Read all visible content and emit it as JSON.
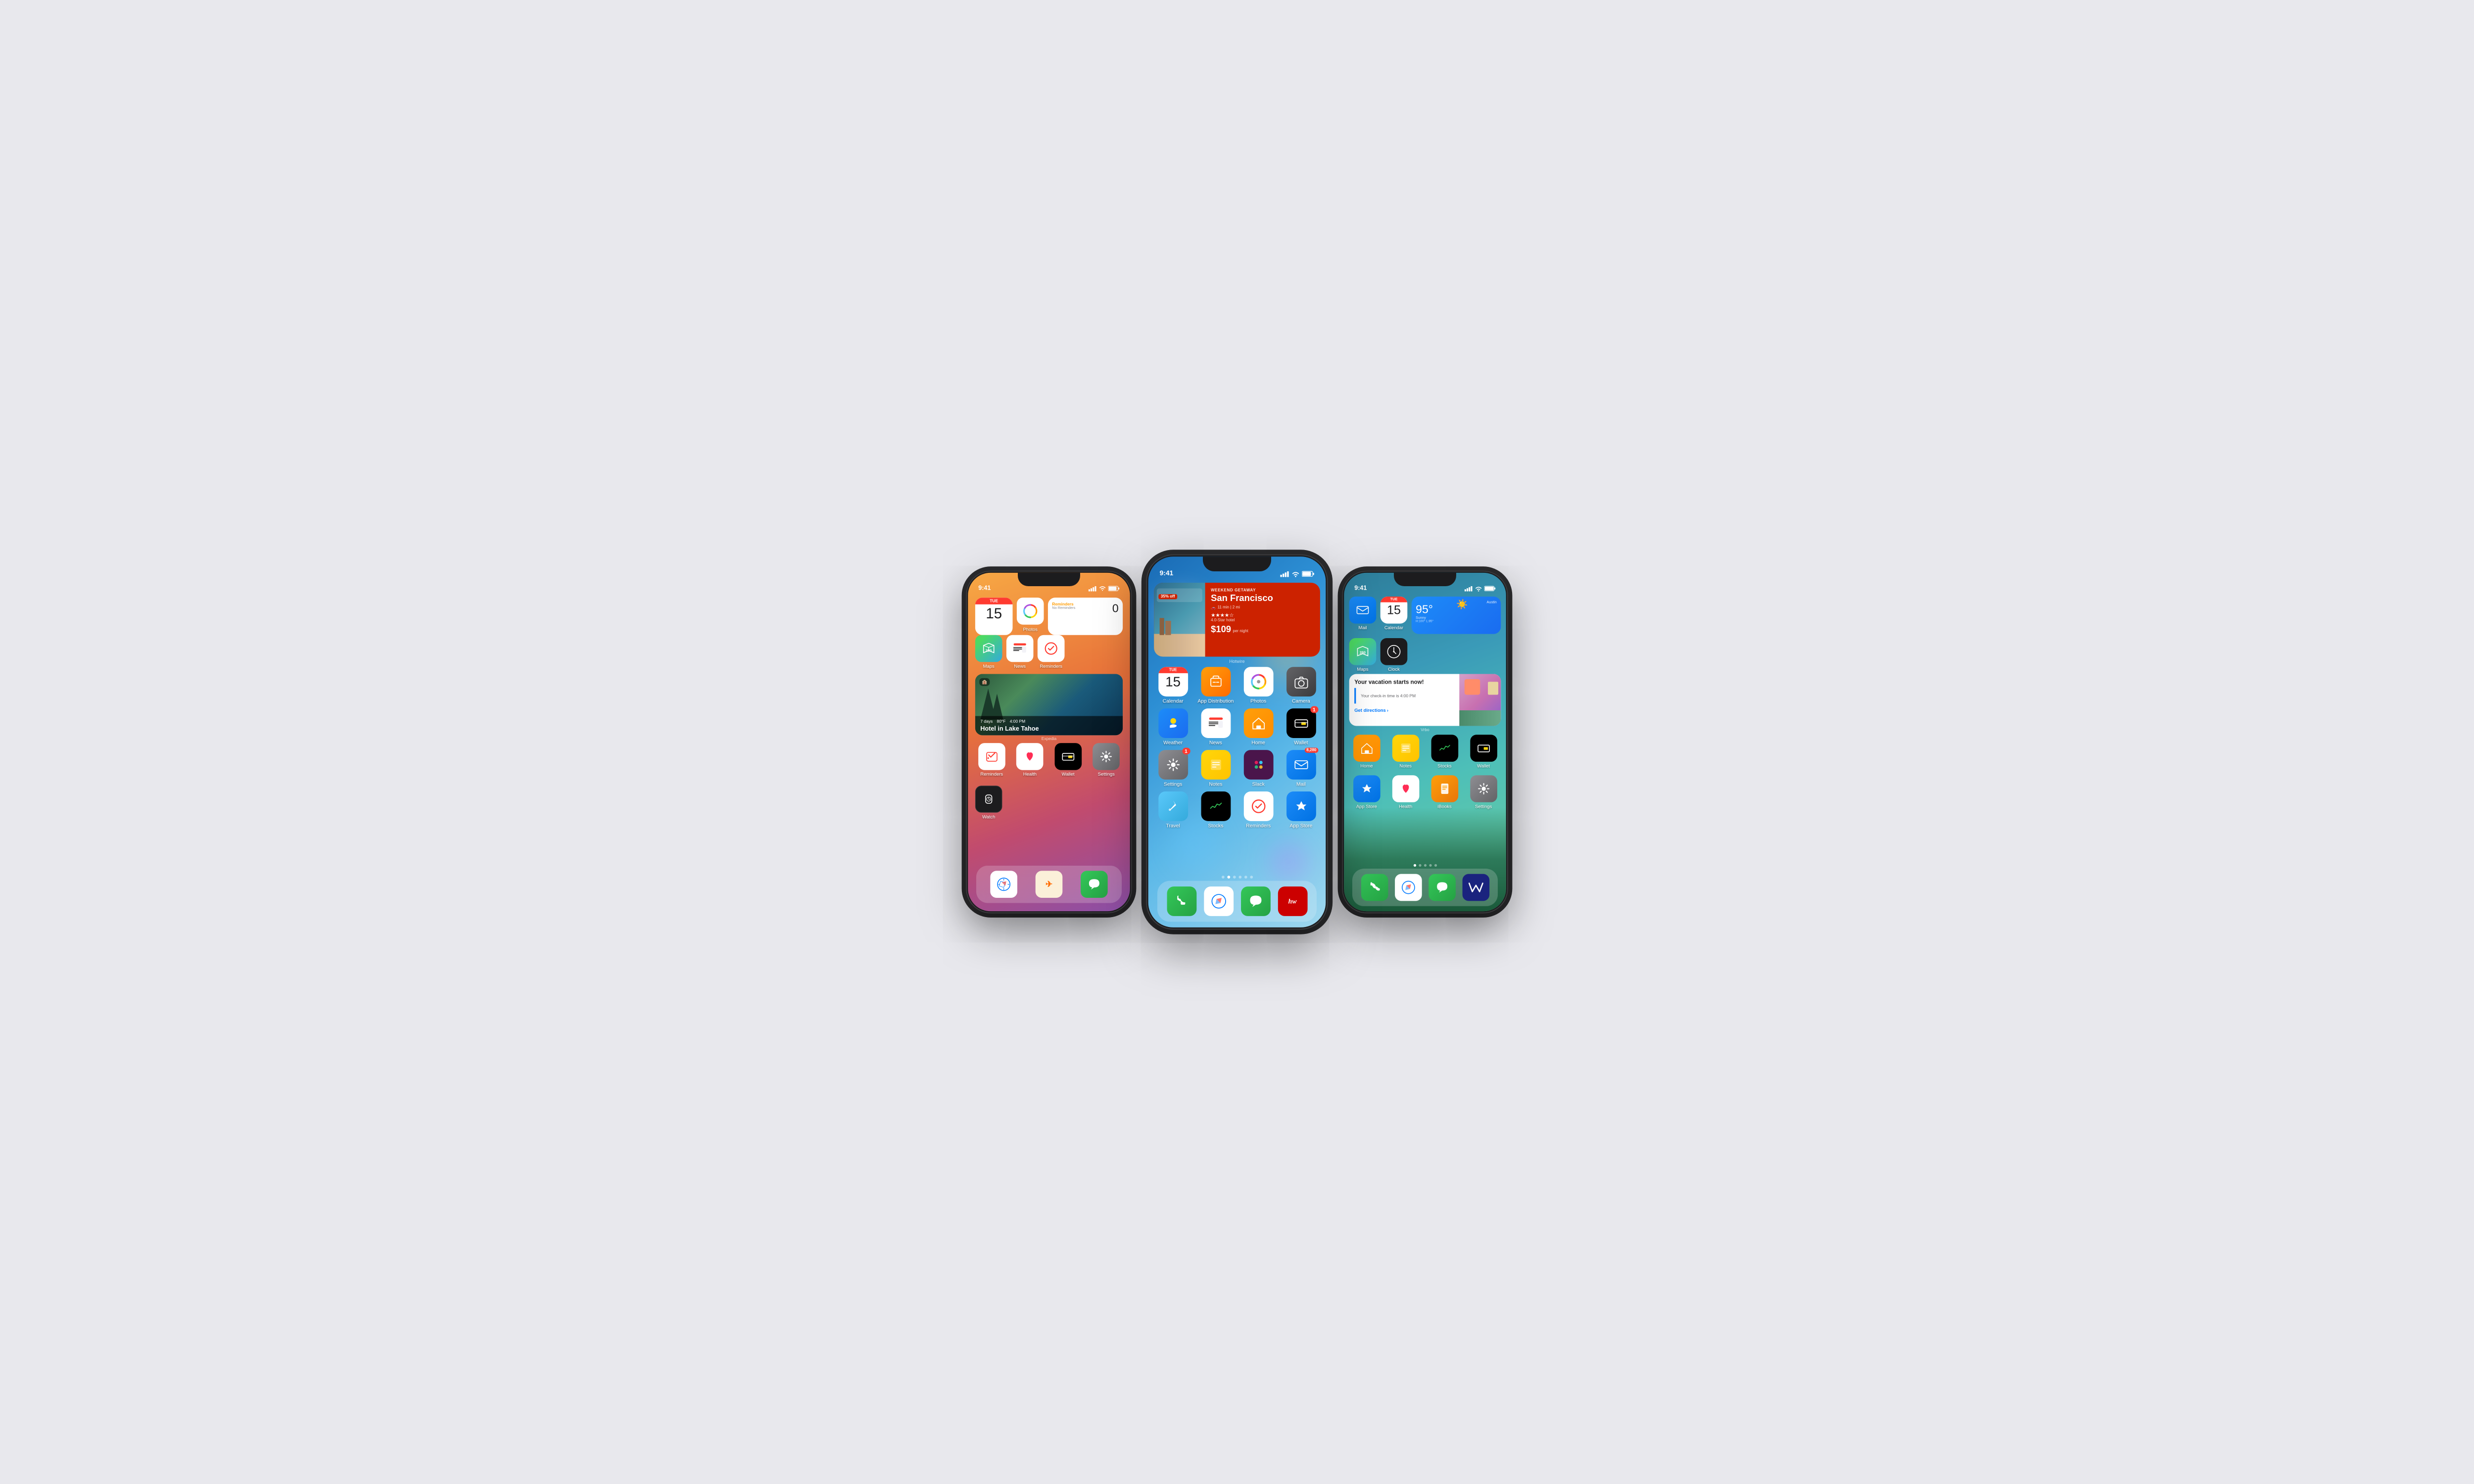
{
  "scene": {
    "bg": "#e8e8ed"
  },
  "statusBar": {
    "time": "9:41",
    "signal": "●●●",
    "wifi": "WiFi",
    "battery": "Battery"
  },
  "phone1": {
    "title": "iPhone 1",
    "statusTime": "9:41",
    "widgets": {
      "calDay": "15",
      "calDayName": "TUE",
      "remindersTitle": "Reminders",
      "remindersSubtitle": "No Reminders",
      "remindersCount": "0"
    },
    "expedia": {
      "label": "Expedia",
      "title": "Hotel in Lake Tahoe",
      "info1": "7 days",
      "info2": "80°F",
      "info3": "4:00 PM"
    },
    "apps": [
      {
        "id": "reminders",
        "label": "Reminders"
      },
      {
        "id": "health",
        "label": "Health"
      },
      {
        "id": "wallet",
        "label": "Wallet"
      },
      {
        "id": "settings",
        "label": "Settings"
      }
    ],
    "dock": [
      {
        "id": "safari",
        "label": "Safari"
      },
      {
        "id": "expedia",
        "label": "Expedia"
      },
      {
        "id": "messages",
        "label": "Messages"
      }
    ],
    "dockApps": [
      {
        "id": "safari",
        "label": "Safari"
      },
      {
        "id": "expedia",
        "label": "Expedia"
      },
      {
        "id": "messages",
        "label": "Messages"
      }
    ],
    "topApps": [
      {
        "id": "calendar",
        "label": "Calendar"
      },
      {
        "id": "photos",
        "label": "Photos"
      },
      {
        "id": "reminders-widget",
        "label": "Reminders"
      }
    ],
    "row2Apps": [
      {
        "id": "maps",
        "label": "Maps"
      },
      {
        "id": "news",
        "label": "News"
      },
      {
        "id": "reminders-inline",
        "label": "Reminders"
      }
    ],
    "bottomApps": [
      {
        "id": "watch",
        "label": "Watch"
      }
    ]
  },
  "phone2": {
    "title": "iPhone 2",
    "statusTime": "9:41",
    "hotwire": {
      "label": "Hotwire",
      "badge": "35% off",
      "title": "San Francisco",
      "subtitle": "WEEKEND GETAWAY",
      "drive": "11 min | 2 mi",
      "stars": "★★★★☆",
      "starsLabel": "4.0-Star hotel",
      "price": "$109",
      "priceLabel": "per night"
    },
    "apps": [
      {
        "id": "calendar",
        "label": "Calendar",
        "badge": null
      },
      {
        "id": "appdistr",
        "label": "App Distribution",
        "badge": null
      },
      {
        "id": "photos",
        "label": "Photos",
        "badge": null
      },
      {
        "id": "camera",
        "label": "Camera",
        "badge": null
      },
      {
        "id": "weather",
        "label": "Weather",
        "badge": null
      },
      {
        "id": "news",
        "label": "News",
        "badge": null
      },
      {
        "id": "home",
        "label": "Home",
        "badge": null
      },
      {
        "id": "wallet",
        "label": "Wallet",
        "badge": "1"
      },
      {
        "id": "settings",
        "label": "Settings",
        "badge": "1"
      },
      {
        "id": "notes",
        "label": "Notes",
        "badge": null
      },
      {
        "id": "slack",
        "label": "Slack",
        "badge": null
      },
      {
        "id": "mail",
        "label": "Mail",
        "badge": "8,280"
      },
      {
        "id": "travel",
        "label": "Travel",
        "badge": null
      },
      {
        "id": "stocks",
        "label": "Stocks",
        "badge": null
      },
      {
        "id": "reminders",
        "label": "Reminders",
        "badge": null
      },
      {
        "id": "appstore",
        "label": "App Store",
        "badge": null
      }
    ],
    "dock": [
      {
        "id": "phone",
        "label": "Phone"
      },
      {
        "id": "safari",
        "label": "Safari"
      },
      {
        "id": "messages",
        "label": "Messages"
      },
      {
        "id": "hotwire",
        "label": "Hotwire"
      }
    ]
  },
  "phone3": {
    "title": "iPhone 3",
    "statusTime": "9:41",
    "weather": {
      "city": "Austin",
      "temp": "95°",
      "condition": "Sunny",
      "high": "H:100°",
      "low": "L:85°"
    },
    "vrbo": {
      "label": "Vrbo",
      "title": "Your vacation starts now!",
      "subtitle": "Your check-in time is 4:00 PM",
      "cta": "Get directions"
    },
    "topApps": [
      {
        "id": "mail",
        "label": "Mail"
      },
      {
        "id": "calendar",
        "label": "Calendar"
      },
      {
        "id": "weather-widget",
        "label": "Weather"
      }
    ],
    "row2Apps": [
      {
        "id": "maps",
        "label": "Maps"
      },
      {
        "id": "clock",
        "label": "Clock"
      }
    ],
    "mainApps": [
      {
        "id": "home",
        "label": "Home"
      },
      {
        "id": "notes",
        "label": "Notes"
      },
      {
        "id": "stocks",
        "label": "Stocks"
      },
      {
        "id": "wallet",
        "label": "Wallet"
      },
      {
        "id": "appstore",
        "label": "App Store"
      },
      {
        "id": "health",
        "label": "Health"
      },
      {
        "id": "ibooks",
        "label": "iBooks"
      },
      {
        "id": "settings",
        "label": "Settings"
      }
    ],
    "dock": [
      {
        "id": "phone",
        "label": "Phone"
      },
      {
        "id": "safari",
        "label": "Safari"
      },
      {
        "id": "messages",
        "label": "Messages"
      },
      {
        "id": "vrbo-app",
        "label": "Vrbo"
      }
    ]
  }
}
